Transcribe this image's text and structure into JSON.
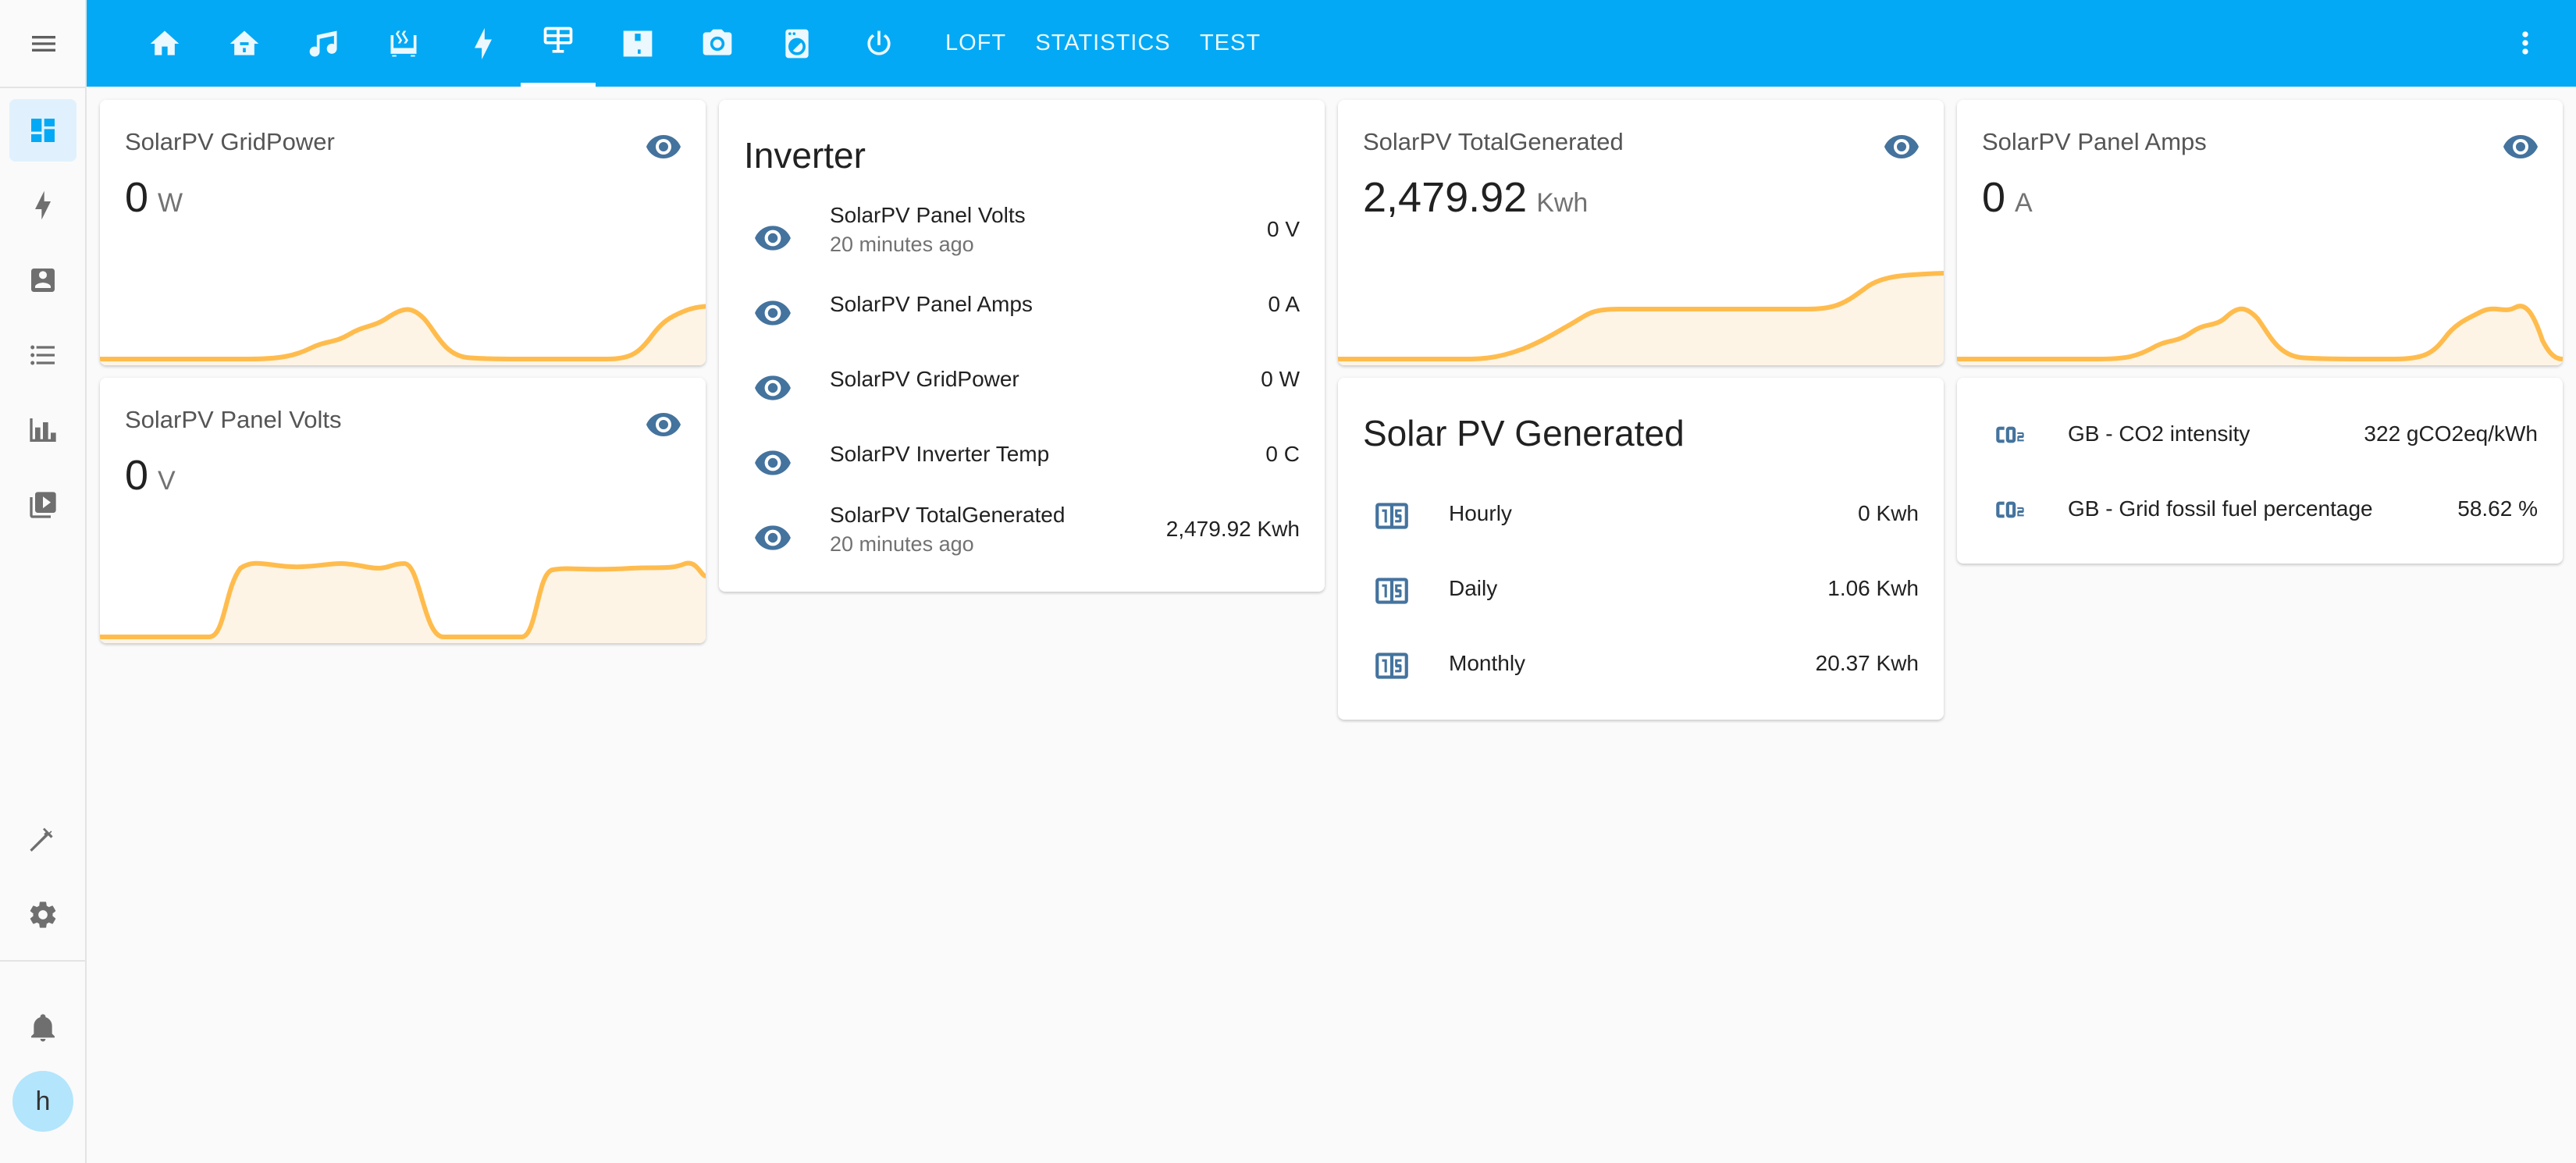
{
  "colors": {
    "accent": "#03a9f4",
    "icon": "#44739e",
    "graph_line": "#ffbc4d",
    "graph_fill": "#fdf4e6"
  },
  "sidebar": {
    "items": [
      {
        "icon": "menu-icon"
      },
      {
        "icon": "dashboard-icon",
        "selected": true
      },
      {
        "icon": "lightning-icon"
      },
      {
        "icon": "account-box-icon"
      },
      {
        "icon": "list-icon"
      },
      {
        "icon": "chart-icon"
      },
      {
        "icon": "media-icon"
      },
      {
        "icon": "hammer-icon"
      },
      {
        "icon": "gear-icon"
      },
      {
        "icon": "bell-icon"
      }
    ],
    "avatar_letter": "h"
  },
  "header": {
    "icon_tabs": [
      "home-icon",
      "home-floor-icon",
      "music-icon",
      "radiator-icon",
      "lightning-icon",
      "solar-panel-icon",
      "floor-plan-icon",
      "camera-icon",
      "washing-machine-icon",
      "power-icon"
    ],
    "active_tab_index": 5,
    "text_tabs": [
      "LOFT",
      "STATISTICS",
      "TEST"
    ]
  },
  "cards": {
    "grid_power": {
      "name": "SolarPV GridPower",
      "value": "0",
      "unit": "W"
    },
    "panel_volts": {
      "name": "SolarPV Panel Volts",
      "value": "0",
      "unit": "V"
    },
    "total_generated": {
      "name": "SolarPV TotalGenerated",
      "value": "2,479.92",
      "unit": "Kwh"
    },
    "panel_amps": {
      "name": "SolarPV Panel Amps",
      "value": "0",
      "unit": "A"
    },
    "inverter": {
      "title": "Inverter",
      "rows": [
        {
          "name": "SolarPV Panel Volts",
          "secondary": "20 minutes ago",
          "state": "0 V"
        },
        {
          "name": "SolarPV Panel Amps",
          "secondary": "",
          "state": "0 A"
        },
        {
          "name": "SolarPV GridPower",
          "secondary": "",
          "state": "0 W"
        },
        {
          "name": "SolarPV Inverter Temp",
          "secondary": "",
          "state": "0 C"
        },
        {
          "name": "SolarPV TotalGenerated",
          "secondary": "20 minutes ago",
          "state": "2,479.92 Kwh"
        }
      ]
    },
    "solar_generated": {
      "title": "Solar PV Generated",
      "rows": [
        {
          "name": "Hourly",
          "state": "0 Kwh"
        },
        {
          "name": "Daily",
          "state": "1.06 Kwh"
        },
        {
          "name": "Monthly",
          "state": "20.37 Kwh"
        }
      ]
    },
    "co2": {
      "rows": [
        {
          "name": "GB - CO2 intensity",
          "state": "322 gCO2eq/kWh"
        },
        {
          "name": "GB - Grid fossil fuel percentage",
          "state": "58.62 %"
        }
      ]
    }
  }
}
